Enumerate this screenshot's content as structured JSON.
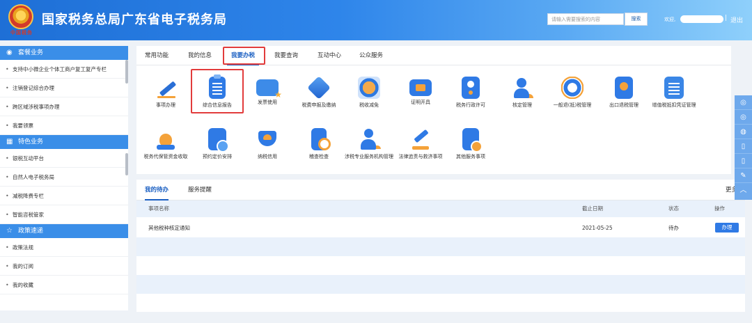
{
  "header": {
    "emblem_text": "中国税务",
    "title": "国家税务总局广东省电子税务局",
    "search_placeholder": "请输入需要搜索的内容",
    "search_button": "搜索",
    "welcome": "欢迎,",
    "logout_sep": "|",
    "logout": "退出"
  },
  "sidebar": {
    "sections": [
      {
        "title": "套餐业务",
        "icon": "package-icon",
        "items": [
          "支持中小微企业个体工商户复工复产专栏",
          "注销登记综合办理",
          "跨区域涉税事项办理",
          "我要领票"
        ]
      },
      {
        "title": "特色业务",
        "icon": "grid-icon",
        "items": [
          "银税互动平台",
          "自然人电子税务局",
          "减税降费专栏",
          "智能咨税管家"
        ]
      },
      {
        "title": "政策速递",
        "icon": "star-icon",
        "items": [
          "政策法规",
          "我的订阅",
          "我的收藏"
        ]
      }
    ]
  },
  "main": {
    "tabs": [
      "常用功能",
      "我的信息",
      "我要办税",
      "我要查询",
      "互动中心",
      "公众服务"
    ],
    "active_tab": 2,
    "services": [
      {
        "label": "事项办理",
        "icon": "pen-icon"
      },
      {
        "label": "综合信息报告",
        "icon": "clipboard-icon"
      },
      {
        "label": "发票使用",
        "icon": "invoice-icon"
      },
      {
        "label": "税费申报及缴纳",
        "icon": "tax-declare-icon"
      },
      {
        "label": "税收减免",
        "icon": "coin-icon"
      },
      {
        "label": "证明开具",
        "icon": "certificate-icon"
      },
      {
        "label": "税务行政许可",
        "icon": "license-icon"
      },
      {
        "label": "核定管理",
        "icon": "person-gear-icon"
      },
      {
        "label": "一般退(抵)税管理",
        "icon": "refund-icon"
      },
      {
        "label": "出口退税管理",
        "icon": "export-icon"
      },
      {
        "label": "增值税抵扣凭证管理",
        "icon": "chip-icon"
      },
      {
        "label": "税务代保管资金收取",
        "icon": "money-bag-icon"
      },
      {
        "label": "预约定价安排",
        "icon": "calendar-icon"
      },
      {
        "label": "纳税信用",
        "icon": "credit-icon"
      },
      {
        "label": "稽查检查",
        "icon": "inspection-icon"
      },
      {
        "label": "涉税专业服务机构管理",
        "icon": "agent-icon"
      },
      {
        "label": "法律追责与救济事项",
        "icon": "gavel-icon"
      },
      {
        "label": "其他服务事项",
        "icon": "other-doc-icon"
      }
    ]
  },
  "todo": {
    "tabs": [
      "我的待办",
      "服务提醒"
    ],
    "more": "更多",
    "columns": [
      "事项名称",
      "截止日期",
      "状态",
      "操作"
    ],
    "rows": [
      {
        "name": "其他税种核定通知",
        "deadline": "2021-05-25",
        "status": "待办",
        "action": "办理"
      }
    ]
  },
  "float_bar": [
    "wechat-icon",
    "weibo-icon",
    "share-icon",
    "phone-icon",
    "mobile-icon",
    "edit-icon",
    "up-arrow-icon"
  ],
  "colors": {
    "primary": "#2f7ae5",
    "highlight": "#e23b3b",
    "accent": "#f4a23a"
  }
}
